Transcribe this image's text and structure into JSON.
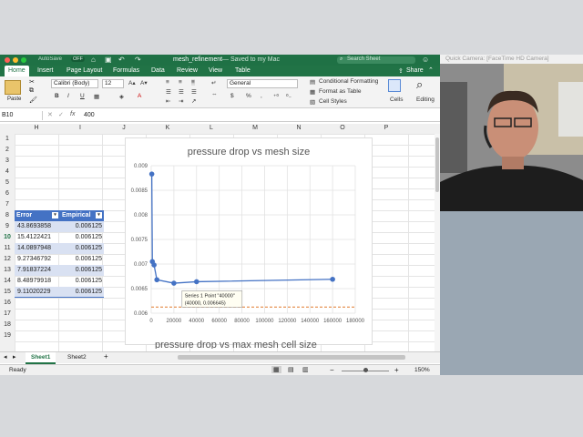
{
  "window": {
    "filename": "mesh_refinement",
    "saved_status": "— Saved to my Mac",
    "autosave": "AutoSave",
    "autosave_state": "OFF",
    "search_placeholder": "Search Sheet"
  },
  "ribbon": {
    "tabs": [
      "Home",
      "Insert",
      "Page Layout",
      "Formulas",
      "Data",
      "Review",
      "View",
      "Table"
    ],
    "active_tab": "Home",
    "share_label": "Share",
    "paste_label": "Paste",
    "font_name": "Calibri (Body)",
    "font_size": "12",
    "number_format": "General",
    "cond_format": "Conditional Formatting",
    "format_table": "Format as Table",
    "cell_styles": "Cell Styles",
    "cells_label": "Cells",
    "editing_label": "Editing",
    "bold": "B",
    "italic": "I",
    "underline": "U",
    "percent": "%",
    "comma": ",",
    "currency": "$"
  },
  "formula_bar": {
    "name_box": "B10",
    "fx": "fx",
    "value": "400"
  },
  "columns": [
    "H",
    "I",
    "J",
    "K",
    "L",
    "M",
    "N",
    "O",
    "P"
  ],
  "rows": [
    "1",
    "2",
    "3",
    "4",
    "5",
    "6",
    "7",
    "8",
    "9",
    "10",
    "11",
    "12",
    "13",
    "14",
    "15",
    "16",
    "17",
    "18",
    "19"
  ],
  "table": {
    "headers": [
      "Error",
      "Empirical"
    ],
    "rows": [
      [
        "43.8693858",
        "0.006125"
      ],
      [
        "15.4122421",
        "0.006125"
      ],
      [
        "14.0897948",
        "0.006125"
      ],
      [
        "9.27346792",
        "0.006125"
      ],
      [
        "7.91837224",
        "0.006125"
      ],
      [
        "8.48979918",
        "0.006125"
      ],
      [
        "9.11020229",
        "0.006125"
      ]
    ]
  },
  "chart_data": {
    "type": "scatter",
    "title": "pressure drop vs mesh size",
    "xlabel": "",
    "ylabel": "",
    "xlim": [
      0,
      180000
    ],
    "ylim": [
      0.006,
      0.009
    ],
    "x_ticks": [
      "0",
      "20000",
      "40000",
      "60000",
      "80000",
      "100000",
      "120000",
      "140000",
      "160000",
      "180000"
    ],
    "y_ticks": [
      "0.006",
      "0.0065",
      "0.007",
      "0.0075",
      "0.008",
      "0.0085",
      "0.009"
    ],
    "series": [
      {
        "name": "Series 1",
        "x": [
          500,
          1000,
          2500,
          5000,
          20000,
          40000,
          160000
        ],
        "y": [
          0.00883,
          0.00705,
          0.00698,
          0.00668,
          0.00661,
          0.00664,
          0.00669
        ]
      }
    ],
    "reference_line": 0.006125,
    "tooltip": {
      "title": "Series 1 Point \"40000\"",
      "value": "(40000, 0.006645)"
    },
    "grid": true,
    "legend": "none"
  },
  "second_chart_title": "pressure drop vs max mesh cell size",
  "sheets": [
    "Sheet1",
    "Sheet2"
  ],
  "status": {
    "ready": "Ready",
    "zoom": "150%",
    "add_sheet": "+"
  },
  "webcam": {
    "title": "Quick Camera: [FaceTime HD Camera]"
  },
  "colors": {
    "excel_green": "#217346",
    "table_header": "#4472c4",
    "series": "#4472c4",
    "ref_line": "#e07a2e"
  }
}
